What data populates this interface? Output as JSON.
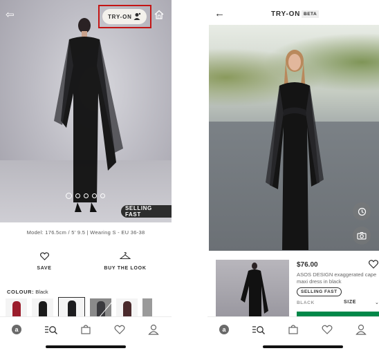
{
  "left_screen": {
    "try_on_label": "TRY-ON",
    "selling_fast": "SELLING FAST",
    "model_info": "Model: 176.5cm / 5' 9.5 | Wearing S - EU 36-38",
    "save_label": "SAVE",
    "buy_the_look_label": "BUY THE LOOK",
    "colour_label": "COLOUR:",
    "colour_value": "Black",
    "carousel": {
      "count": 5,
      "active_index": 0
    },
    "icons": [
      "back-arrow-icon",
      "home-icon",
      "avatar-icon",
      "heart-icon",
      "hanger-icon"
    ],
    "highlight_color": "#c41414"
  },
  "right_screen": {
    "title": "TRY-ON",
    "beta": "BETA",
    "price": "$76.00",
    "description": "ASOS DESIGN exaggerated cape maxi dress in black",
    "selling_fast": "SELLING FAST",
    "colour": "BLACK",
    "size_label": "SIZE",
    "icons": [
      "back-arrow-icon",
      "history-icon",
      "camera-icon",
      "heart-icon",
      "chevron-down-icon"
    ],
    "add_button_color": "#018849"
  },
  "tabbar": {
    "tabs": [
      "home-tab",
      "search-tab",
      "bag-tab",
      "saved-tab",
      "account-tab"
    ]
  }
}
